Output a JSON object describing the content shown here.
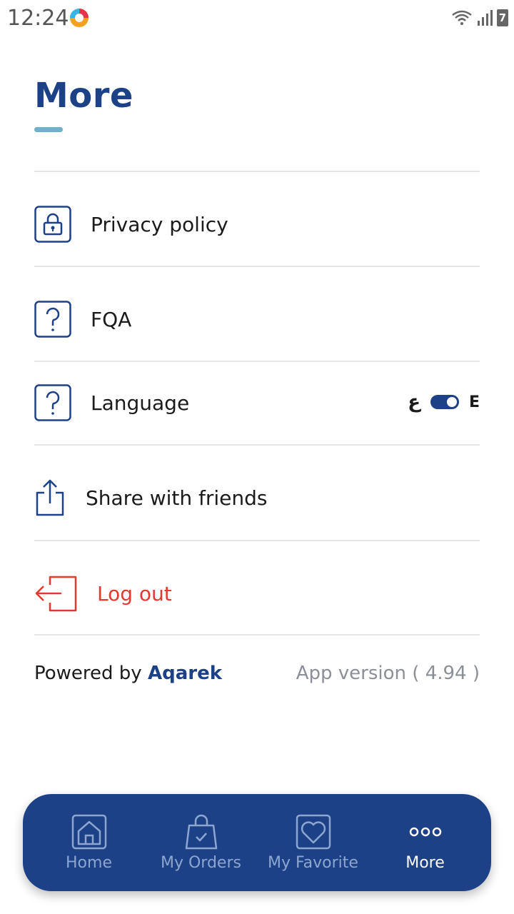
{
  "status_bar": {
    "time": "12:24",
    "battery_level": "7"
  },
  "header": {
    "title": "More"
  },
  "menu": {
    "privacy": {
      "label": "Privacy policy",
      "icon": "lock-icon"
    },
    "faq": {
      "label": "FQA",
      "icon": "question-icon"
    },
    "language": {
      "label": "Language",
      "icon": "question-icon",
      "option_ar": "ع",
      "option_en": "E",
      "toggle_on": true
    },
    "share": {
      "label": "Share with friends",
      "icon": "share-icon"
    },
    "logout": {
      "label": "Log out",
      "icon": "logout-icon"
    }
  },
  "footer": {
    "powered_by": "Powered by",
    "brand": "Aqarek",
    "app_version": "App version ( 4.94 )"
  },
  "nav": {
    "home": "Home",
    "orders": "My Orders",
    "favorite": "My Favorite",
    "more": "More",
    "active": "More"
  },
  "colors": {
    "primary": "#1c4187",
    "accent": "#6fb0cc",
    "danger": "#e5392f",
    "muted": "#8a8f98",
    "nav_inactive": "#8ea6cf"
  }
}
